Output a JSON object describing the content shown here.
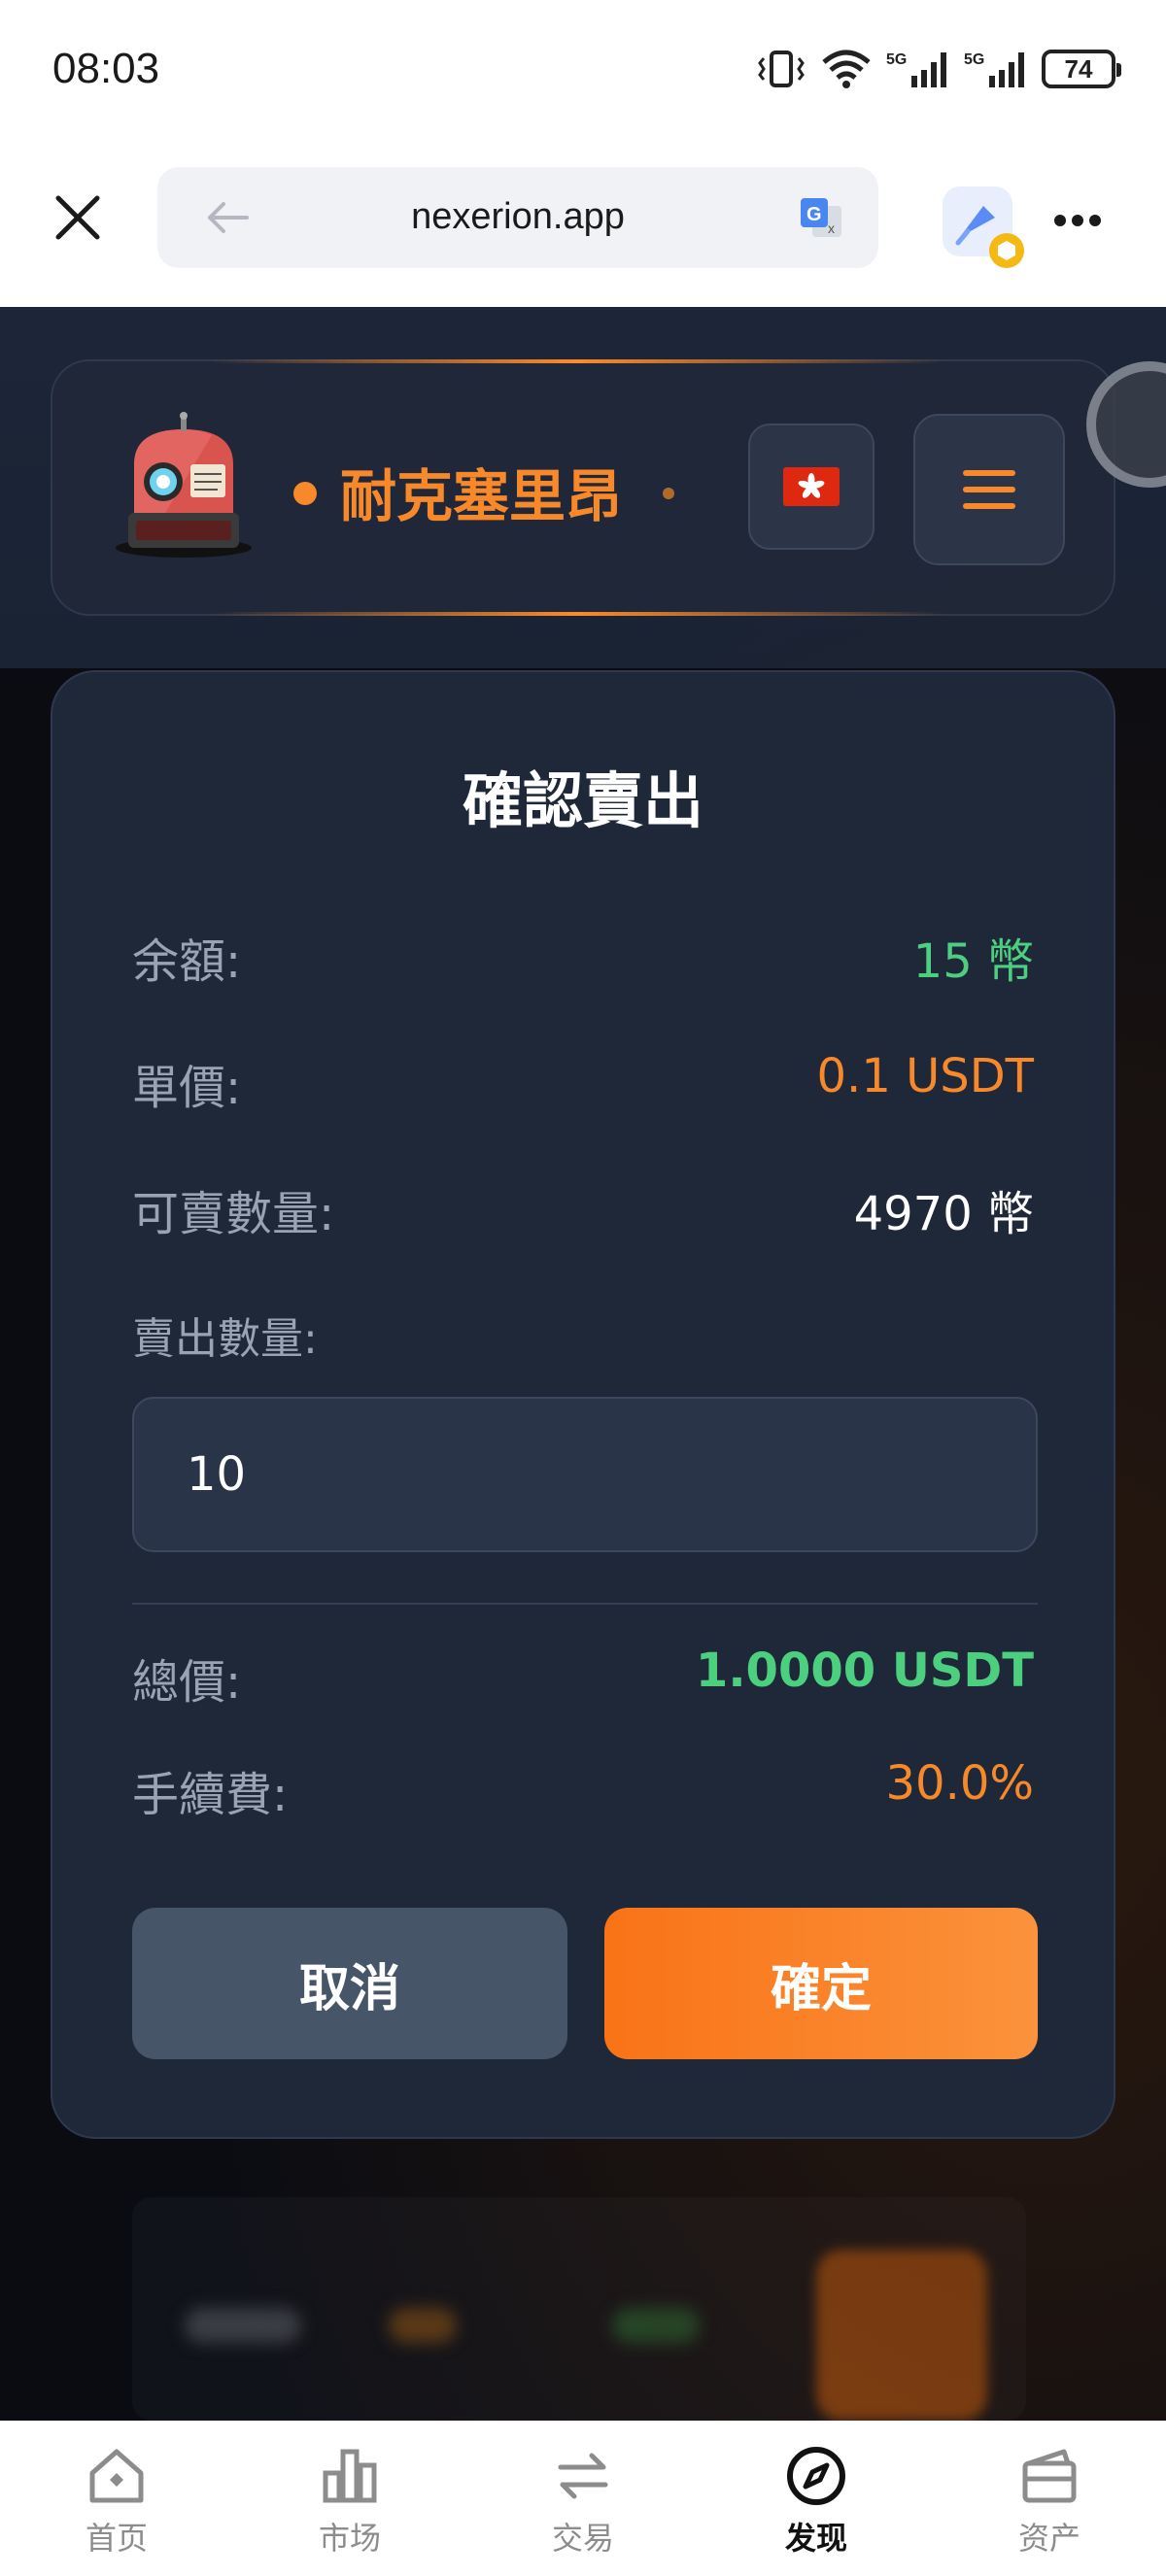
{
  "status_bar": {
    "time": "08:03",
    "battery": "74",
    "network_1": "5G",
    "network_2": "5G"
  },
  "browser": {
    "url": "nexerion.app",
    "icons": [
      "close-icon",
      "back-arrow-icon",
      "translate-icon",
      "extension-icon",
      "more-icon"
    ]
  },
  "header": {
    "brand_title": "耐克塞里昂",
    "language_flag": "hong-kong-flag-icon",
    "menu_icon": "hamburger-menu-icon"
  },
  "dialog": {
    "title": "確認賣出",
    "balance_label": "余額:",
    "balance_value": "15 幣",
    "unit_price_label": "單價:",
    "unit_price_value": "0.1 USDT",
    "sellable_label": "可賣數量:",
    "sellable_value": "4970 幣",
    "sell_qty_label": "賣出數量:",
    "sell_qty_value": "10",
    "total_label": "總價:",
    "total_value": "1.0000 USDT",
    "fee_label": "手續費:",
    "fee_value": "30.0%",
    "cancel_label": "取消",
    "confirm_label": "確定"
  },
  "bottom_nav": {
    "items": [
      {
        "label": "首页",
        "icon": "home-icon",
        "active": false
      },
      {
        "label": "市场",
        "icon": "market-chart-icon",
        "active": false
      },
      {
        "label": "交易",
        "icon": "trade-swap-icon",
        "active": false
      },
      {
        "label": "发现",
        "icon": "discover-compass-icon",
        "active": true
      },
      {
        "label": "资产",
        "icon": "wallet-icon",
        "active": false
      }
    ]
  },
  "colors": {
    "accent_orange": "#f7892b",
    "positive_green": "#4cd080",
    "dialog_bg": "#1f2839"
  }
}
